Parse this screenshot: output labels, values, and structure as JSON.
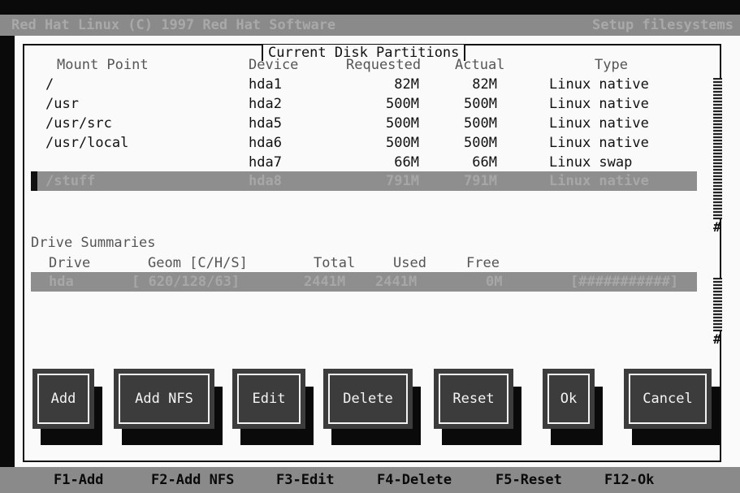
{
  "window": {
    "title_left": "Red Hat Linux (C) 1997 Red Hat Software",
    "title_right": "Setup filesystems"
  },
  "dialog": {
    "title": "Current Disk Partitions"
  },
  "partitions": {
    "headers": [
      "Mount Point",
      "Device",
      "Requested",
      "Actual",
      "Type"
    ],
    "rows": [
      {
        "mount": "/",
        "device": "hda1",
        "requested": "82M",
        "actual": "82M",
        "type": "Linux native"
      },
      {
        "mount": "/usr",
        "device": "hda2",
        "requested": "500M",
        "actual": "500M",
        "type": "Linux native"
      },
      {
        "mount": "/usr/src",
        "device": "hda5",
        "requested": "500M",
        "actual": "500M",
        "type": "Linux native"
      },
      {
        "mount": "/usr/local",
        "device": "hda6",
        "requested": "500M",
        "actual": "500M",
        "type": "Linux native"
      },
      {
        "mount": "",
        "device": "hda7",
        "requested": "66M",
        "actual": "66M",
        "type": "Linux swap"
      }
    ],
    "selected": {
      "mount": "/stuff",
      "device": "hda8",
      "requested": "791M",
      "actual": "791M",
      "type": "Linux native"
    },
    "scroll_mark": "#"
  },
  "drives": {
    "section_label": "Drive Summaries",
    "headers": [
      "Drive",
      "Geom [C/H/S]",
      "Total",
      "Used",
      "Free"
    ],
    "selected": {
      "drive": "hda",
      "geom": "[ 620/128/63]",
      "total": "2441M",
      "used": "2441M",
      "free": "0M",
      "bar": "[###########]"
    },
    "scroll_mark": "#"
  },
  "buttons": [
    "Add",
    "Add NFS",
    "Edit",
    "Delete",
    "Reset",
    "Ok",
    "Cancel"
  ],
  "fkeys": [
    "F1-Add",
    "F2-Add NFS",
    "F3-Edit",
    "F4-Delete",
    "F5-Reset",
    "F12-Ok"
  ]
}
